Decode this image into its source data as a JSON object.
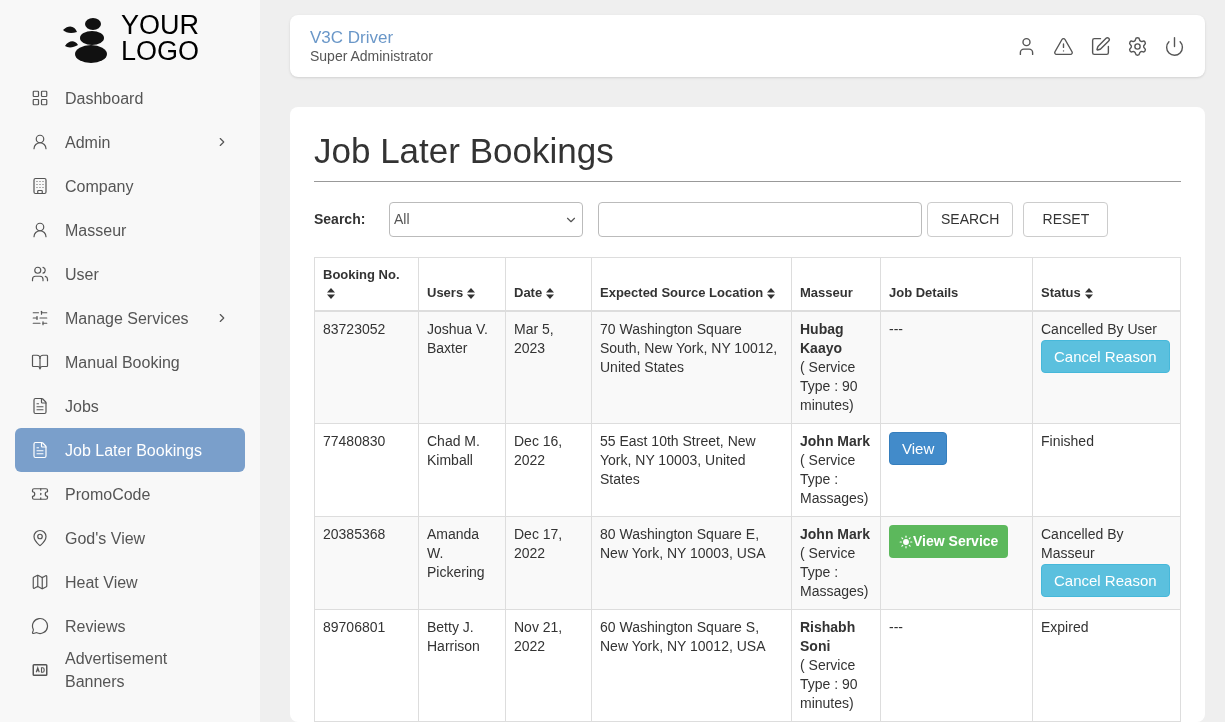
{
  "logo": {
    "line_1": "YOUR",
    "line_2": "LOGO"
  },
  "sidebar": {
    "items": [
      {
        "label": "Dashboard",
        "selected": false,
        "has_submenu": false
      },
      {
        "label": "Admin",
        "selected": false,
        "has_submenu": true
      },
      {
        "label": "Company",
        "selected": false,
        "has_submenu": false
      },
      {
        "label": "Masseur",
        "selected": false,
        "has_submenu": false
      },
      {
        "label": "User",
        "selected": false,
        "has_submenu": false
      },
      {
        "label": "Manage Services",
        "selected": false,
        "has_submenu": true
      },
      {
        "label": "Manual Booking",
        "selected": false,
        "has_submenu": false
      },
      {
        "label": "Jobs",
        "selected": false,
        "has_submenu": false
      },
      {
        "label": "Job Later Bookings",
        "selected": true,
        "has_submenu": false
      },
      {
        "label": "PromoCode",
        "selected": false,
        "has_submenu": false
      },
      {
        "label": "God's View",
        "selected": false,
        "has_submenu": false
      },
      {
        "label": "Heat View",
        "selected": false,
        "has_submenu": false
      },
      {
        "label": "Reviews",
        "selected": false,
        "has_submenu": false
      },
      {
        "label": "Advertisement Banners",
        "selected": false,
        "has_submenu": false
      }
    ]
  },
  "header": {
    "user_name": "V3C Driver",
    "role": "Super Administrator"
  },
  "page": {
    "title": "Job Later Bookings",
    "search": {
      "label": "Search:",
      "filter_value": "All",
      "search_button": "SEARCH",
      "reset_button": "RESET"
    },
    "table": {
      "columns": [
        {
          "label": "Booking No.",
          "sortable": true
        },
        {
          "label": "Users",
          "sortable": true
        },
        {
          "label": "Date",
          "sortable": true
        },
        {
          "label": "Expected Source Location",
          "sortable": true
        },
        {
          "label": "Masseur",
          "sortable": false
        },
        {
          "label": "Job Details",
          "sortable": false
        },
        {
          "label": "Status",
          "sortable": true
        }
      ],
      "rows": [
        {
          "booking_no": "83723052",
          "user": "Joshua V. Baxter",
          "date": "Mar 5, 2023",
          "location": "70 Washington Square South, New York, NY 10012, United States",
          "masseur": "Hubag Kaayo",
          "service": "( Service Type : 90 minutes)",
          "job_details": {
            "kind": "none",
            "text": "---"
          },
          "status": "Cancelled By User",
          "status_action": "Cancel Reason"
        },
        {
          "booking_no": "77480830",
          "user": "Chad M. Kimball",
          "date": "Dec 16, 2022",
          "location": "55 East 10th Street, New York, NY 10003, United States",
          "masseur": "John Mark",
          "service": "( Service Type : Massages)",
          "job_details": {
            "kind": "view",
            "text": "View"
          },
          "status": "Finished"
        },
        {
          "booking_no": "20385368",
          "user": "Amanda W. Pickering",
          "date": "Dec 17, 2022",
          "location": "80 Washington Square E, New York, NY 10003, USA",
          "masseur": "John Mark",
          "service": "( Service Type : Massages)",
          "job_details": {
            "kind": "view_service",
            "text": "View Service"
          },
          "status": "Cancelled By Masseur",
          "status_action": "Cancel Reason"
        },
        {
          "booking_no": "89706801",
          "user": "Betty J. Harrison",
          "date": "Nov 21, 2022",
          "location": "60 Washington Square S, New York, NY 10012, USA",
          "masseur": "Rishabh Soni",
          "service": "( Service Type : 90 minutes)",
          "job_details": {
            "kind": "none",
            "text": "---"
          },
          "status": "Expired"
        }
      ]
    }
  }
}
